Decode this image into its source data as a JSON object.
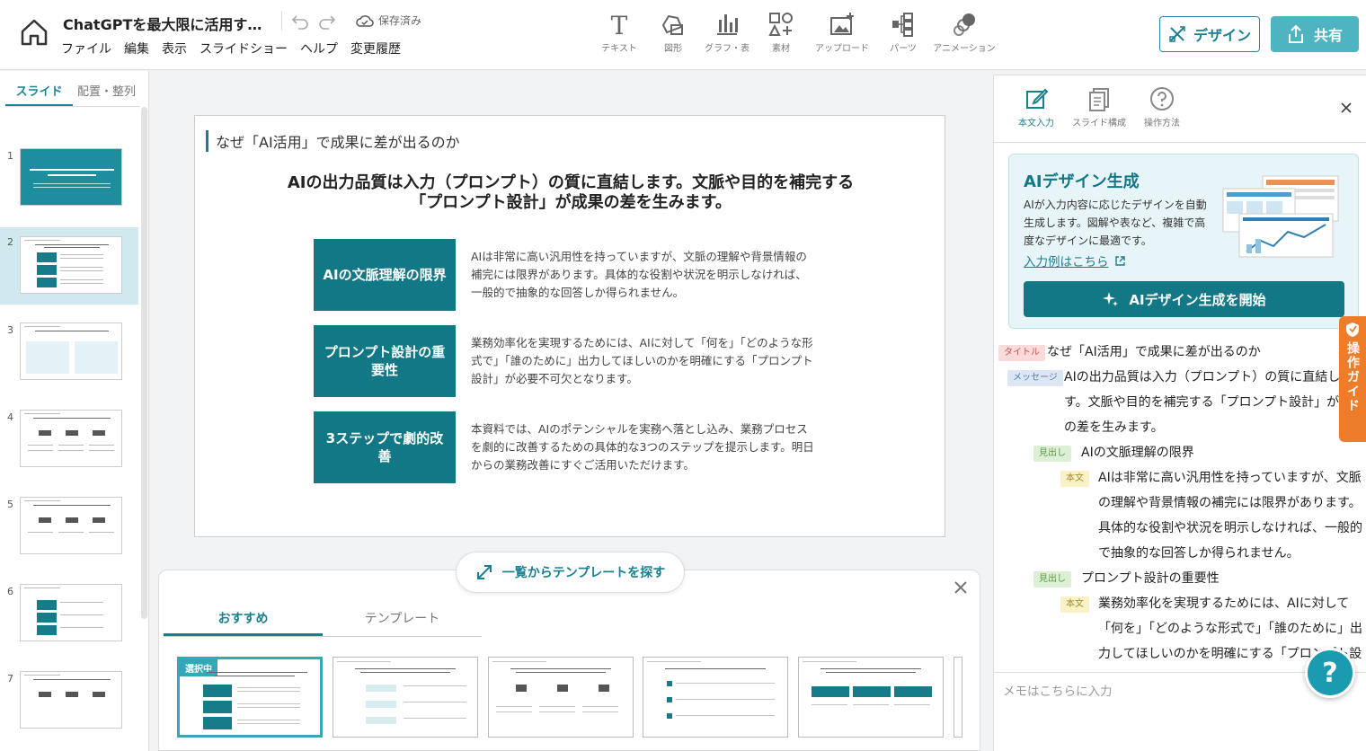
{
  "header": {
    "doc_title": "ChatGPTを最大限に活用するためのコツ",
    "save_status": "保存済み",
    "menu": [
      "ファイル",
      "編集",
      "表示",
      "スライドショー",
      "ヘルプ",
      "変更履歴"
    ],
    "tools": [
      {
        "label": "テキスト",
        "icon": "text-icon"
      },
      {
        "label": "図形",
        "icon": "shape-icon"
      },
      {
        "label": "グラフ・表",
        "icon": "chart-icon"
      },
      {
        "label": "素材",
        "icon": "material-icon"
      },
      {
        "label": "アップロード",
        "icon": "upload-icon"
      },
      {
        "label": "パーツ",
        "icon": "parts-icon"
      },
      {
        "label": "アニメーション",
        "icon": "animation-icon"
      }
    ],
    "design_label": "デザイン",
    "share_label": "共有"
  },
  "left_panel": {
    "tabs": [
      "スライド",
      "配置・整列"
    ],
    "slides": [
      "1",
      "2",
      "3",
      "4",
      "5",
      "6",
      "7"
    ],
    "selected_slide": 2
  },
  "slide": {
    "title": "なぜ「AI活用」で成果に差が出るのか",
    "message_line1": "AIの出力品質は入力（プロンプト）の質に直結します。文脈や目的を補完する",
    "message_line2": "「プロンプト設計」が成果の差を生みます。",
    "rows": [
      {
        "heading": "AIの文脈理解の限界",
        "body": "AIは非常に高い汎用性を持っていますが、文脈の理解や背景情報の補完には限界があります。具体的な役割や状況を明示しなければ、一般的で抽象的な回答しか得られません。"
      },
      {
        "heading": "プロンプト設計の重要性",
        "body": "業務効率化を実現するためには、AIに対して「何を」「どのような形式で」「誰のために」出力してほしいのかを明確にする「プロンプト設計」が必要不可欠となります。"
      },
      {
        "heading": "3ステップで劇的改善",
        "body": "本資料では、AIのポテンシャルを実務へ落とし込み、業務プロセスを劇的に改善するための具体的な3つのステップを提示します。明日からの業務改善にすぐご活用いただけます。"
      }
    ]
  },
  "template_panel": {
    "find_label": "一覧からテンプレートを探す",
    "tabs": [
      "おすすめ",
      "テンプレート"
    ],
    "selected_badge": "選択中"
  },
  "right_panel": {
    "tabs": [
      "本文入力",
      "スライド構成",
      "操作方法"
    ],
    "ai_card": {
      "title": "AIデザイン生成",
      "desc": "AIが入力内容に応じたデザインを自動生成します。図解や表など、複雑で高度なデザインに最適です。",
      "link": "入力例はこちら",
      "start_label": "AIデザイン生成を開始"
    },
    "guide_label": "操作ガイド",
    "outline": {
      "tag_title": "タイトル",
      "tag_message": "メッセージ",
      "tag_heading": "見出し",
      "tag_body": "本文",
      "title_text": "なぜ「AI活用」で成果に差が出るのか",
      "msg_l1": "AIの出力品質は入力（プロンプト）の質に直結し",
      "msg_l2": "す。文脈や目的を補完する「プロンプト設計」が",
      "msg_l3": "の差を生みます。",
      "h1": "AIの文脈理解の限界",
      "b1_l1": "AIは非常に高い汎用性を持っていますが、文脈",
      "b1_l2": "の理解や背景情報の補完には限界があります。",
      "b1_l3": "具体的な役割や状況を明示しなければ、一般的",
      "b1_l4": "で抽象的な回答しか得られません。",
      "h2": "プロンプト設計の重要性",
      "b2_l1": "業務効率化を実現するためには、AIに対して",
      "b2_l2": "「何を」「どのような形式で」「誰のために」出",
      "b2_l3": "力してほしいのかを明確にする「プロンプト設"
    },
    "memo_placeholder": "メモはこちらに入力"
  },
  "colors": {
    "accent": "#137886",
    "accent_light": "#4eb4c2",
    "guide": "#ee7d2b"
  }
}
